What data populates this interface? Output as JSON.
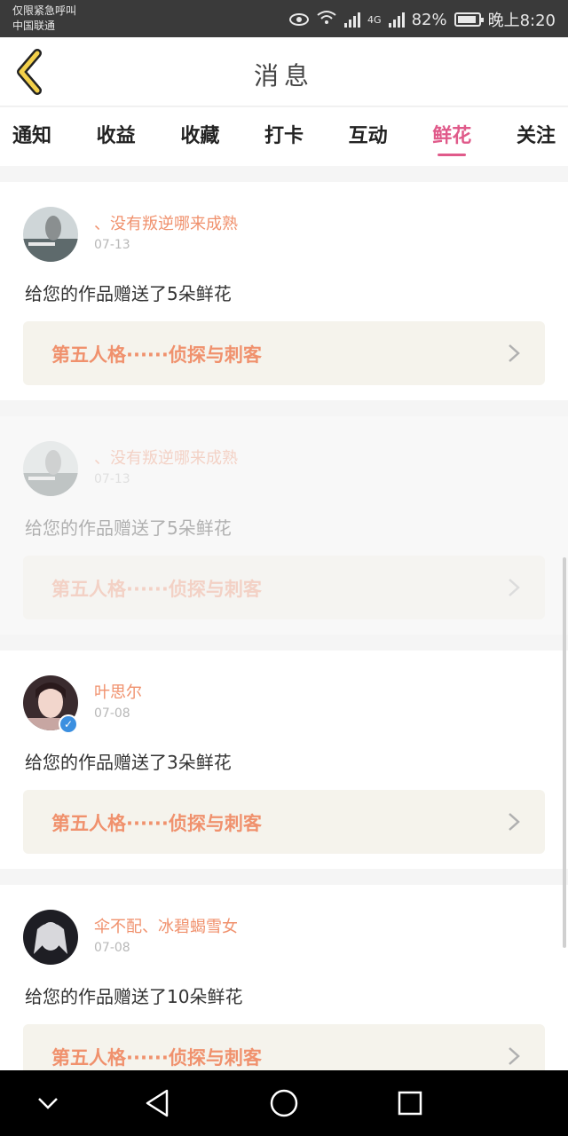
{
  "status_bar": {
    "line1": "仅限紧急呼叫",
    "line2": "中国联通",
    "network": "4G",
    "battery": "82%",
    "time": "晚上8:20"
  },
  "header": {
    "title": "消息"
  },
  "tabs": [
    {
      "label": "通知"
    },
    {
      "label": "收益"
    },
    {
      "label": "收藏"
    },
    {
      "label": "打卡"
    },
    {
      "label": "互动"
    },
    {
      "label": "鲜花",
      "active": true
    },
    {
      "label": "关注"
    }
  ],
  "notifications": [
    {
      "user": "、没有叛逆哪来成熟",
      "date": "07-13",
      "message": "给您的作品赠送了5朵鲜花",
      "work_title": "第五人格······侦探与刺客"
    },
    {
      "user": "、没有叛逆哪来成熟",
      "date": "07-13",
      "message": "给您的作品赠送了5朵鲜花",
      "work_title": "第五人格······侦探与刺客"
    },
    {
      "user": "叶思尔",
      "date": "07-08",
      "message": "给您的作品赠送了3朵鲜花",
      "work_title": "第五人格······侦探与刺客"
    },
    {
      "user": "伞不配、冰碧蝎雪女",
      "date": "07-08",
      "message": "给您的作品赠送了10朵鲜花",
      "work_title": "第五人格······侦探与刺客"
    }
  ],
  "colors": {
    "accent": "#e05a8a",
    "name_orange": "#f0916d",
    "back_arrow": "#f3d04a"
  }
}
